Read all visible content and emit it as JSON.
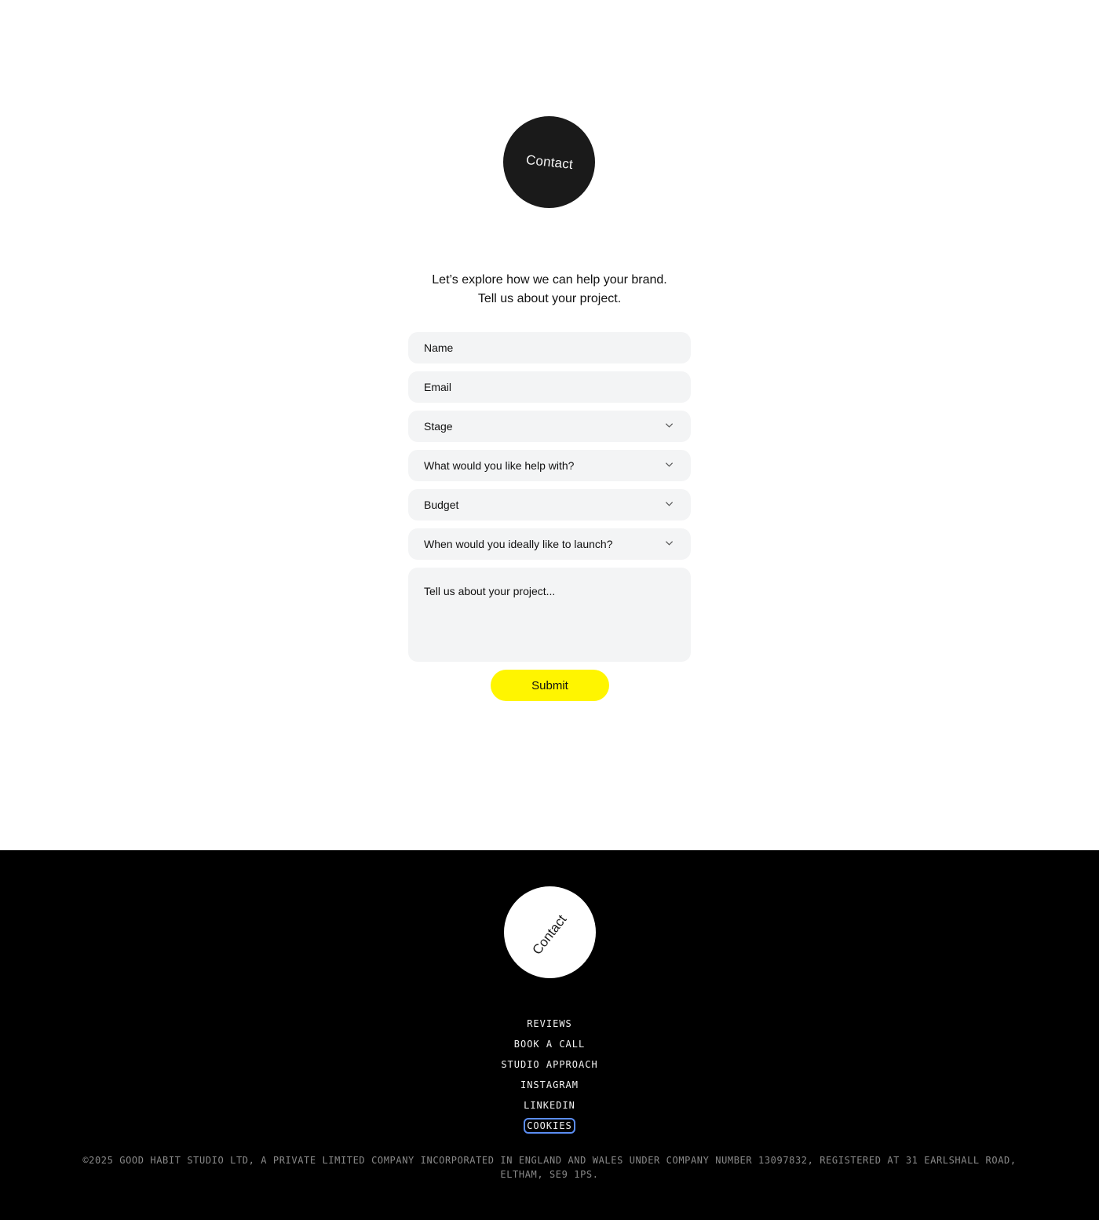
{
  "header": {
    "contact_badge_label": "Contact"
  },
  "intro": {
    "line1": "Let’s explore how we can help your brand.",
    "line2": "Tell us about your project."
  },
  "form": {
    "name_placeholder": "Name",
    "email_placeholder": "Email",
    "stage_label": "Stage",
    "help_label": "What would you like help with?",
    "budget_label": "Budget",
    "launch_label": "When would you ideally like to launch?",
    "project_placeholder": "Tell us about your project...",
    "submit_label": "Submit"
  },
  "colors": {
    "accent": "#fff500",
    "field_bg": "#f3f4f5",
    "footer_bg": "#000000",
    "badge_dark": "#1a1a1a"
  },
  "footer": {
    "contact_badge_label": "Contact",
    "nav": [
      {
        "label": "REVIEWS"
      },
      {
        "label": "BOOK A CALL"
      },
      {
        "label": "STUDIO APPROACH"
      },
      {
        "label": "INSTAGRAM"
      },
      {
        "label": "LINKEDIN"
      },
      {
        "label": "COOKIES"
      }
    ],
    "legal_line1": "©2025 GOOD HABIT STUDIO LTD, A PRIVATE LIMITED COMPANY INCORPORATED IN ENGLAND AND WALES UNDER COMPANY NUMBER 13097832, REGISTERED AT 31 EARLSHALL ROAD,",
    "legal_line2": "ELTHAM, SE9 1PS."
  }
}
